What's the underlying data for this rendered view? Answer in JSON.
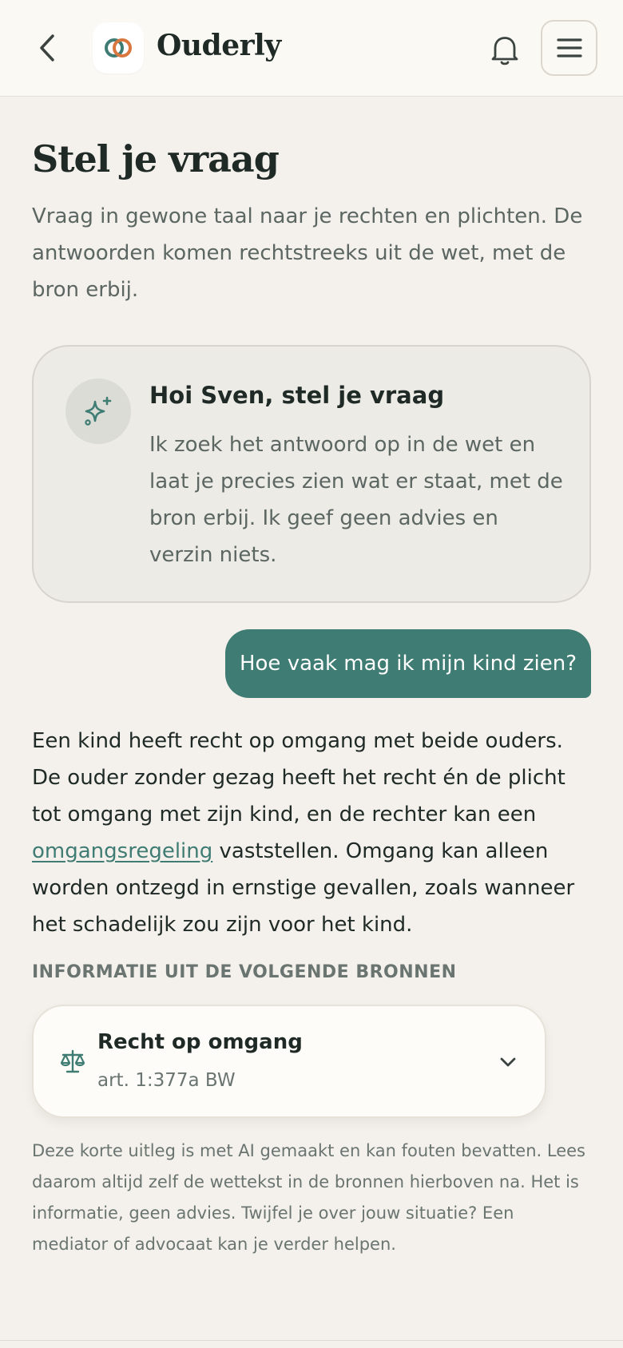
{
  "header": {
    "brand": "Ouderly",
    "back_icon": "chevron-left-icon",
    "logo_icon": "interlocking-rings-logo",
    "bell_icon": "bell-icon",
    "menu_icon": "hamburger-menu-icon"
  },
  "page": {
    "title": "Stel je vraag",
    "intro": "Vraag in gewone taal naar je rechten en plichten. De antwoorden komen rechtstreeks uit de wet, met de bron erbij."
  },
  "assistant_intro": {
    "icon": "sparkle-icon",
    "title": "Hoi Sven, stel je vraag",
    "body": "Ik zoek het antwoord op in de wet en laat je precies zien wat er staat, met de bron erbij. Ik geef geen advies en verzin niets."
  },
  "user_message": "Hoe vaak mag ik mijn kind zien?",
  "answer": {
    "part1": "Een kind heeft recht op omgang met beide ouders. De ouder zonder gezag heeft het recht én de plicht tot omgang met zijn kind, en de rechter kan een ",
    "link": "omgangsregeling",
    "part2": " vaststellen. Omgang kan alleen worden ontzegd in ernstige gevallen, zoals wanneer het schadelijk zou zijn voor het kind."
  },
  "sources": {
    "heading": "INFORMATIE UIT DE VOLGENDE BRONNEN",
    "items": [
      {
        "icon": "scale-icon",
        "title": "Recht op omgang",
        "ref": "art. 1:377a BW"
      }
    ]
  },
  "disclaimer": "Deze korte uitleg is met AI gemaakt en kan fouten bevatten. Lees daarom altijd zelf de wettekst in de bronnen hierboven na. Het is informatie, geen advies. Twijfel je over jouw situatie? Een mediator of advocaat kan je verder helpen.",
  "colors": {
    "accent": "#3f7c73",
    "logo_orange": "#d9773f",
    "background": "#f4f1ec"
  }
}
